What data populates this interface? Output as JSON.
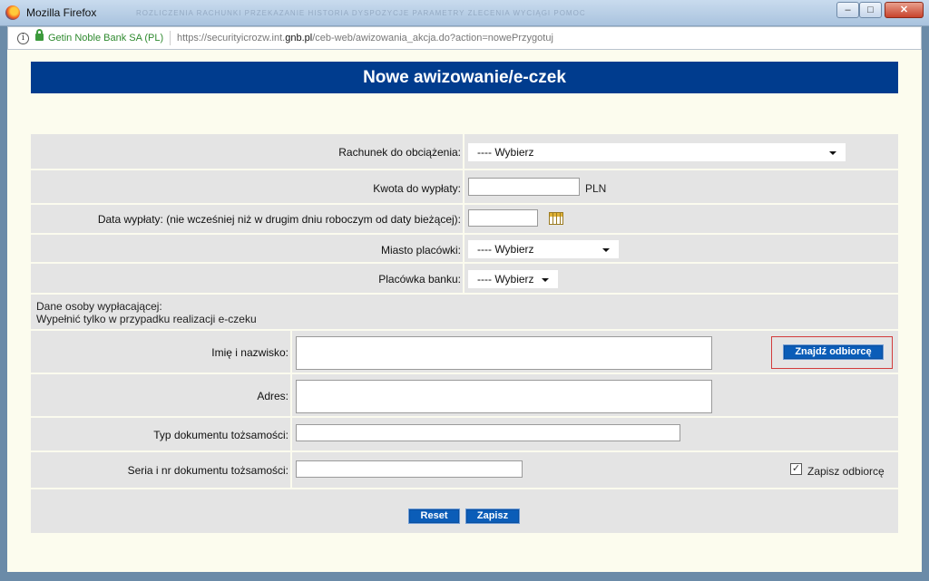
{
  "window": {
    "title": "Mozilla Firefox",
    "ghost_menu": "ROZLICZENIA   RACHUNKI   PRZEKAZANIE   HISTORIA   DYSPOZYCJE   PARAMETRY   ZLECENIA   WYCIĄGI   POMOC",
    "minimize": "–",
    "maximize": "□",
    "close": "✕"
  },
  "urlbar": {
    "site_identity": "Getin Noble Bank SA (PL)",
    "url_prefix": "https://securityicrozw.int.",
    "url_domain": "gnb.pl",
    "url_suffix": "/ceb-web/awizowania_akcja.do?action=nowePrzygotuj"
  },
  "page": {
    "title": "Nowe awizowanie/e-czek"
  },
  "form": {
    "account_label": "Rachunek do obciążenia:",
    "account_value": "---- Wybierz",
    "amount_label": "Kwota do wypłaty:",
    "amount_value": "",
    "currency": "PLN",
    "date_label": "Data wypłaty: (nie wcześniej niż w drugim dniu roboczym od daty bieżącej):",
    "date_value": "",
    "city_label": "Miasto placówki:",
    "city_value": "---- Wybierz",
    "branch_label": "Placówka banku:",
    "branch_value": "---- Wybierz",
    "person_section_line1": "Dane osoby wypłacającej:",
    "person_section_line2": "Wypełnić tylko w przypadku realizacji e-czeku",
    "name_label": "Imię i nazwisko:",
    "name_value": "",
    "find_button": "Znajdź odbiorcę",
    "address_label": "Adres:",
    "address_value": "",
    "doc_type_label": "Typ dokumentu tożsamości:",
    "doc_type_value": "",
    "doc_number_label": "Seria i nr dokumentu tożsamości:",
    "doc_number_value": "",
    "save_recipient_label": "Zapisz odbiorcę",
    "save_recipient_checked": true,
    "reset_button": "Reset",
    "save_button": "Zapisz"
  }
}
